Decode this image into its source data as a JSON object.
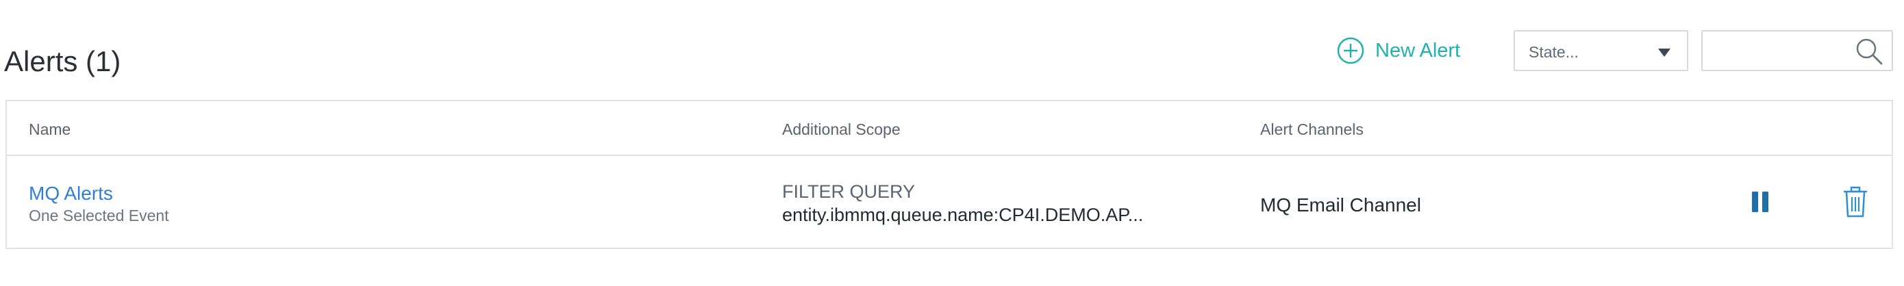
{
  "header": {
    "title": "Alerts (1)",
    "new_alert_label": "New Alert",
    "new_alert_icon": "plus-circle-icon",
    "state_placeholder": "State...",
    "search_value": "",
    "search_icon": "search-icon"
  },
  "colors": {
    "accent_teal": "#20b2aa",
    "link_blue": "#2f7fd6",
    "action_blue": "#1f6fa8",
    "border": "#dfe3e8"
  },
  "table": {
    "columns": [
      "Name",
      "Additional Scope",
      "Alert Channels"
    ],
    "rows": [
      {
        "name": "MQ Alerts",
        "subtitle": "One Selected Event",
        "scope_label": "FILTER QUERY",
        "scope_value": "entity.ibmmq.queue.name:CP4I.DEMO.AP...",
        "channels": "MQ Email Channel",
        "actions": [
          "pause-icon",
          "trash-icon"
        ]
      }
    ]
  }
}
